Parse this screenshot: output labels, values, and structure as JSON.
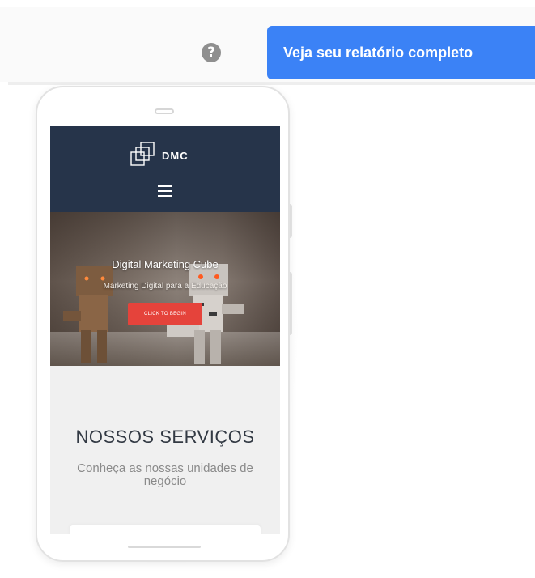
{
  "toolbar": {
    "help_icon": "question-mark-icon",
    "help_glyph": "?",
    "report_button_label": "Veja seu relatório completo",
    "accent_color": "#3b82f6"
  },
  "phone_preview": {
    "site": {
      "logo_text": "DMC",
      "logo_icon": "stacked-squares-logo",
      "menu_icon": "hamburger-menu-icon",
      "header_color": "#26344a",
      "hero": {
        "title": "Digital Marketing Cube",
        "subtitle": "Marketing Digital para a Educação",
        "cta_label": "CLICK TO BEGIN",
        "cta_color": "#e5433b"
      },
      "services": {
        "title": "NOSSOS SERVIÇOS",
        "subtitle": "Conheça as nossas unidades de negócio"
      }
    }
  }
}
